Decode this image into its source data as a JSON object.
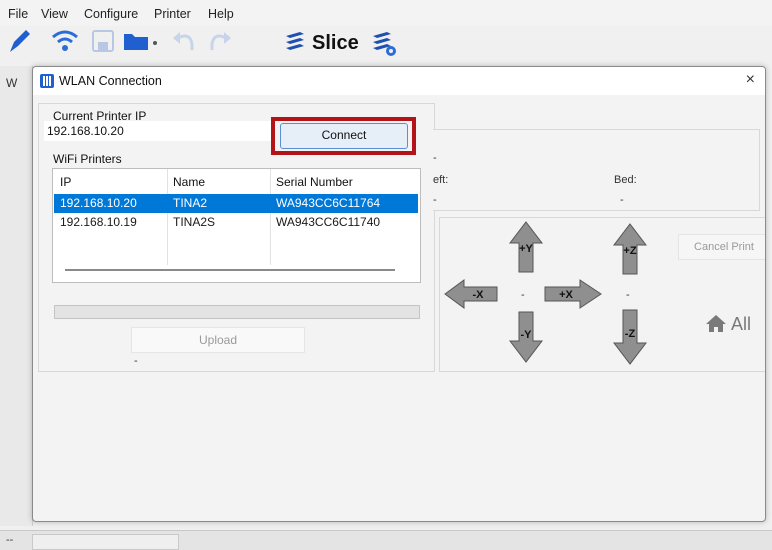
{
  "menubar": {
    "items": [
      "File",
      "View",
      "Configure",
      "Printer",
      "Help"
    ]
  },
  "toolbar": {
    "slice_label": "Slice",
    "icons": [
      "pen-icon",
      "wifi-icon",
      "save-icon",
      "folder-icon",
      "undo-icon",
      "redo-icon",
      "layers-icon",
      "layers-gear-icon"
    ]
  },
  "background": {
    "window_letter": "W",
    "status_text": "--"
  },
  "dialog": {
    "title": "WLAN Connection",
    "close_glyph": "×",
    "current_ip_label": "Current Printer IP",
    "current_ip_value": "192.168.10.20",
    "connect_label": "Connect",
    "wifi_printers_label": "WiFi Printers",
    "table": {
      "columns": [
        "IP",
        "Name",
        "Serial Number"
      ],
      "rows": [
        {
          "ip": "192.168.10.20",
          "name": "TINA2",
          "serial": "WA943CC6C11764",
          "selected": true
        },
        {
          "ip": "192.168.10.19",
          "name": "TINA2S",
          "serial": "WA943CC6C11740",
          "selected": false
        }
      ]
    },
    "progress": 0,
    "upload_label": "Upload",
    "upload_status": "-"
  },
  "printer_panel": {
    "left_label": "eft:",
    "bed_label": "Bed:",
    "dash": "-",
    "jog": {
      "plus_y": "+Y",
      "minus_y": "-Y",
      "minus_x": "-X",
      "plus_x": "+X",
      "plus_z": "+Z",
      "minus_z": "-Z"
    },
    "cancel_print": "Cancel Print",
    "home_all": "All"
  },
  "colors": {
    "selection": "#0078d7",
    "highlight_border": "#b3141a",
    "accent_blue": "#2a6dd9"
  }
}
